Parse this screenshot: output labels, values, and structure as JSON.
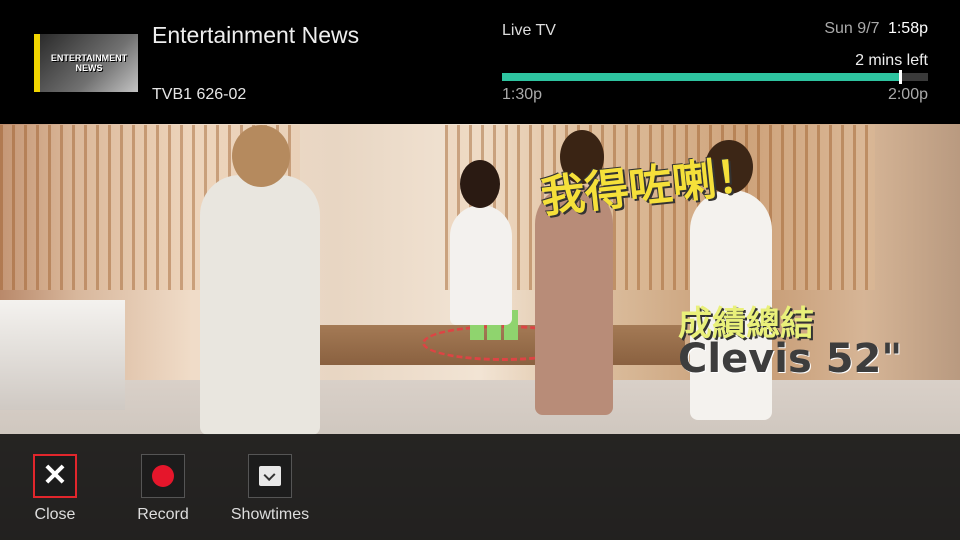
{
  "program": {
    "thumbnail_text": "ENTERTAINMENT NEWS",
    "title": "Entertainment News",
    "channel": "TVB1 626-02"
  },
  "status": {
    "mode": "Live TV",
    "date": "Sun 9/7",
    "time": "1:58p",
    "remaining": "2 mins left",
    "start_time": "1:30p",
    "end_time": "2:00p",
    "progress_fraction": 0.9333,
    "progress_color": "#2ec4a0"
  },
  "video": {
    "captions": [
      "我得咗喇！",
      "成績總結",
      "Clevis 52\""
    ]
  },
  "actions": [
    {
      "label": "Close",
      "icon": "close-icon",
      "selected": true
    },
    {
      "label": "Record",
      "icon": "record-icon",
      "selected": false
    },
    {
      "label": "Showtimes",
      "icon": "clock-icon",
      "selected": false
    }
  ],
  "colors": {
    "selection_border": "#e1262c",
    "record_red": "#e5162b"
  }
}
